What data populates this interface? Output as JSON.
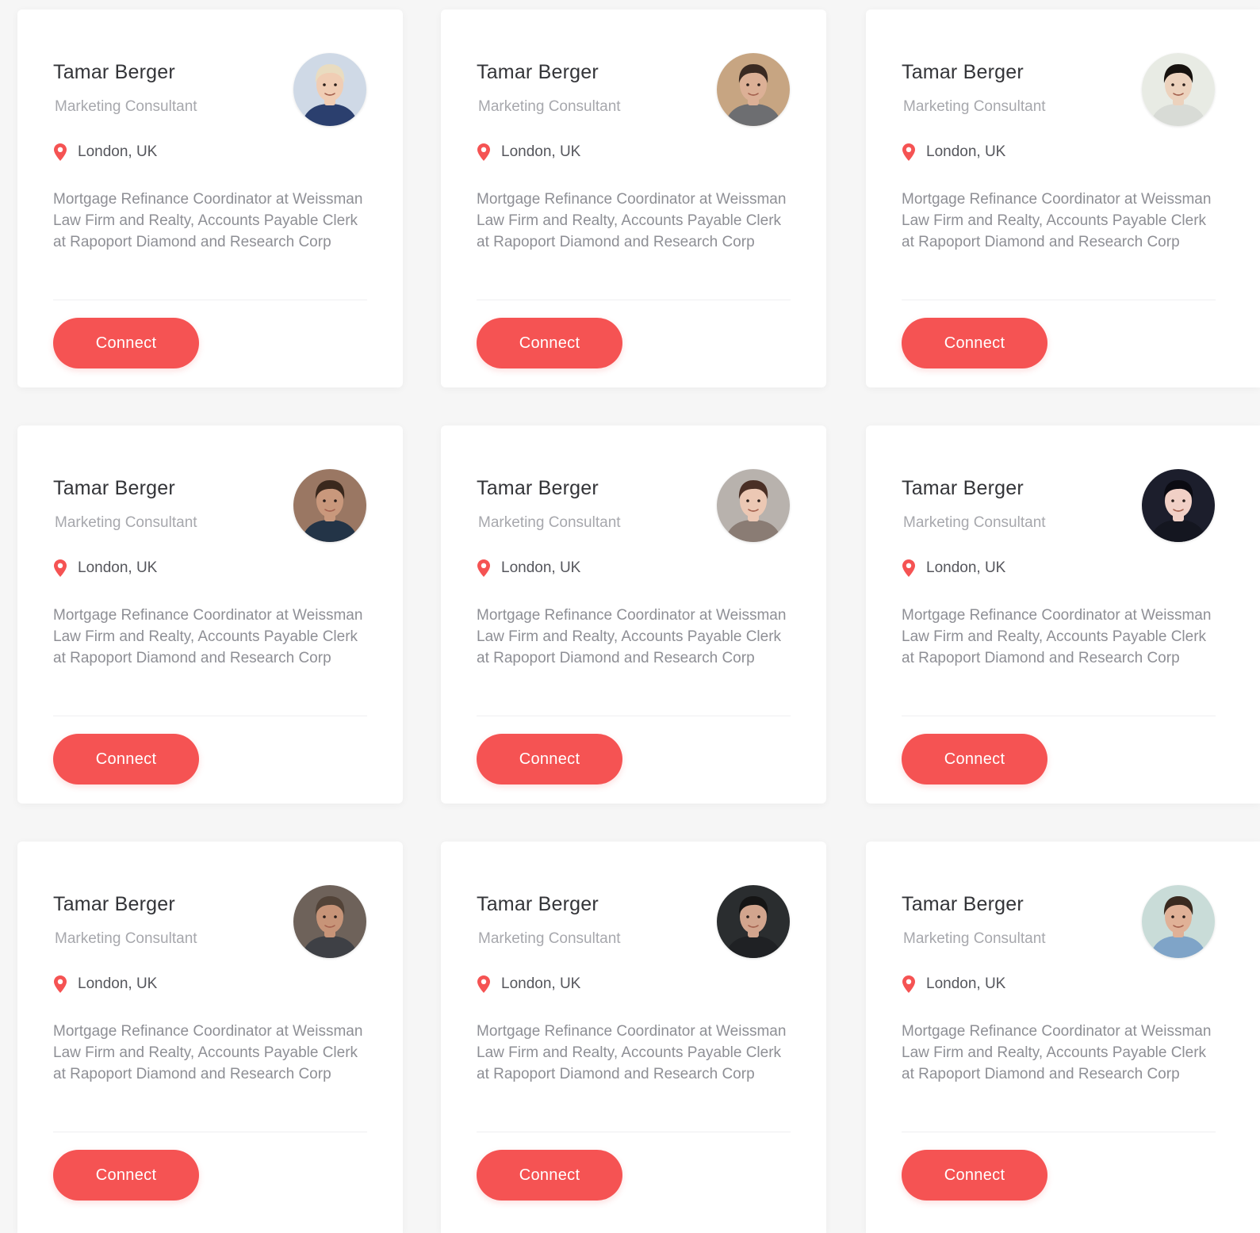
{
  "theme": {
    "accent": "#f55353"
  },
  "cards": [
    {
      "name": "Tamar Berger",
      "role": "Marketing Consultant",
      "location": "London, UK",
      "bio": "Mortgage Refinance Coordinator at Weissman Law Firm and Realty, Accounts Payable Clerk at Rapoport Diamond and Research Corp",
      "button_label": "Connect",
      "avatar": {
        "bg": "#cfd9e6",
        "hair": "#e9dcc0",
        "skin": "#f0cdb4",
        "shirt": "#2b3f6e"
      }
    },
    {
      "name": "Tamar Berger",
      "role": "Marketing Consultant",
      "location": "London, UK",
      "bio": "Mortgage Refinance Coordinator at Weissman Law Firm and Realty, Accounts Payable Clerk at Rapoport Diamond and Research Corp",
      "button_label": "Connect",
      "avatar": {
        "bg": "#c7a582",
        "hair": "#3a2a22",
        "skin": "#dcb096",
        "shirt": "#6d6e71"
      }
    },
    {
      "name": "Tamar Berger",
      "role": "Marketing Consultant",
      "location": "London, UK",
      "bio": "Mortgage Refinance Coordinator at Weissman Law Firm and Realty, Accounts Payable Clerk at Rapoport Diamond and Research Corp",
      "button_label": "Connect",
      "avatar": {
        "bg": "#e8ebe4",
        "hair": "#17120f",
        "skin": "#ecd2bd",
        "shirt": "#d8dbd6"
      }
    },
    {
      "name": "Tamar Berger",
      "role": "Marketing Consultant",
      "location": "London, UK",
      "bio": "Mortgage Refinance Coordinator at Weissman Law Firm and Realty, Accounts Payable Clerk at Rapoport Diamond and Research Corp",
      "button_label": "Connect",
      "avatar": {
        "bg": "#9a7763",
        "hair": "#3a281d",
        "skin": "#c9987c",
        "shirt": "#233447"
      }
    },
    {
      "name": "Tamar Berger",
      "role": "Marketing Consultant",
      "location": "London, UK",
      "bio": "Mortgage Refinance Coordinator at Weissman Law Firm and Realty, Accounts Payable Clerk at Rapoport Diamond and Research Corp",
      "button_label": "Connect",
      "avatar": {
        "bg": "#b8b2ad",
        "hair": "#4a2f25",
        "skin": "#ecc8b4",
        "shirt": "#8a7c74"
      }
    },
    {
      "name": "Tamar Berger",
      "role": "Marketing Consultant",
      "location": "London, UK",
      "bio": "Mortgage Refinance Coordinator at Weissman Law Firm and Realty, Accounts Payable Clerk at Rapoport Diamond and Research Corp",
      "button_label": "Connect",
      "avatar": {
        "bg": "#1c1e2c",
        "hair": "#0b0b12",
        "skin": "#f1d0c6",
        "shirt": "#141620"
      }
    },
    {
      "name": "Tamar Berger",
      "role": "Marketing Consultant",
      "location": "London, UK",
      "bio": "Mortgage Refinance Coordinator at Weissman Law Firm and Realty, Accounts Payable Clerk at Rapoport Diamond and Research Corp",
      "button_label": "Connect",
      "avatar": {
        "bg": "#6e625a",
        "hair": "#524338",
        "skin": "#c79478",
        "shirt": "#3e4045"
      }
    },
    {
      "name": "Tamar Berger",
      "role": "Marketing Consultant",
      "location": "London, UK",
      "bio": "Mortgage Refinance Coordinator at Weissman Law Firm and Realty, Accounts Payable Clerk at Rapoport Diamond and Research Corp",
      "button_label": "Connect",
      "avatar": {
        "bg": "#2a2d2f",
        "hair": "#151515",
        "skin": "#d2a58e",
        "shirt": "#1f2124"
      }
    },
    {
      "name": "Tamar Berger",
      "role": "Marketing Consultant",
      "location": "London, UK",
      "bio": "Mortgage Refinance Coordinator at Weissman Law Firm and Realty, Accounts Payable Clerk at Rapoport Diamond and Research Corp",
      "button_label": "Connect",
      "avatar": {
        "bg": "#c9dcd8",
        "hair": "#3a2a20",
        "skin": "#e0b197",
        "shirt": "#7fa4c8"
      }
    }
  ]
}
